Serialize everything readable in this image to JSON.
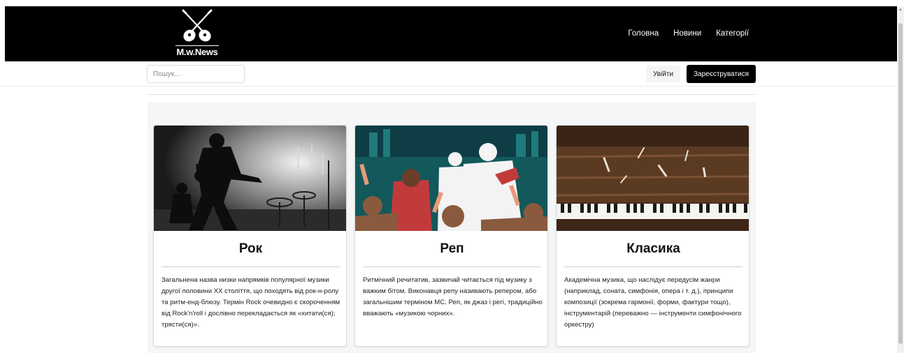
{
  "header": {
    "logo_text": "M.w.News",
    "nav": [
      "Головна",
      "Новини",
      "Категорії"
    ]
  },
  "subbar": {
    "search_placeholder": "Пошук...",
    "login_label": "Увійти",
    "register_label": "Зареєструватися"
  },
  "cards": [
    {
      "title": "Рок",
      "text": "Загальнена назва низки напрямків популярної музики другої половини XX століття, що походять від рок-н-ролу та ритм-енд-блюзу. Термін Rock очевидно є скороченням від Rock'n'roll і дослівно перекладається як «хитати(ся); трясти(ся)»."
    },
    {
      "title": "Реп",
      "text": "Ритмічний речитатив, зазвичай читається під музику з важким бітом. Виконавця репу називають репером, або загальнішим терміном MC. Реп, як джаз і регі, традиційно вважають «музикою чорних»."
    },
    {
      "title": "Класика",
      "text": "Академічна музика, що наслідує передусім жанри (наприклад, соната, симфонія, опера і т. д.), принципи композиції (зокрема гармонії, форми, фактури тощо), інструментарій (переважно — інструменти симфонічного оркестру)"
    }
  ],
  "colors": {
    "header_bg": "#000000",
    "register_bg": "#000000",
    "content_bg": "#f5f6f8"
  },
  "icons": {
    "logo": "crossed-guitars-icon"
  }
}
